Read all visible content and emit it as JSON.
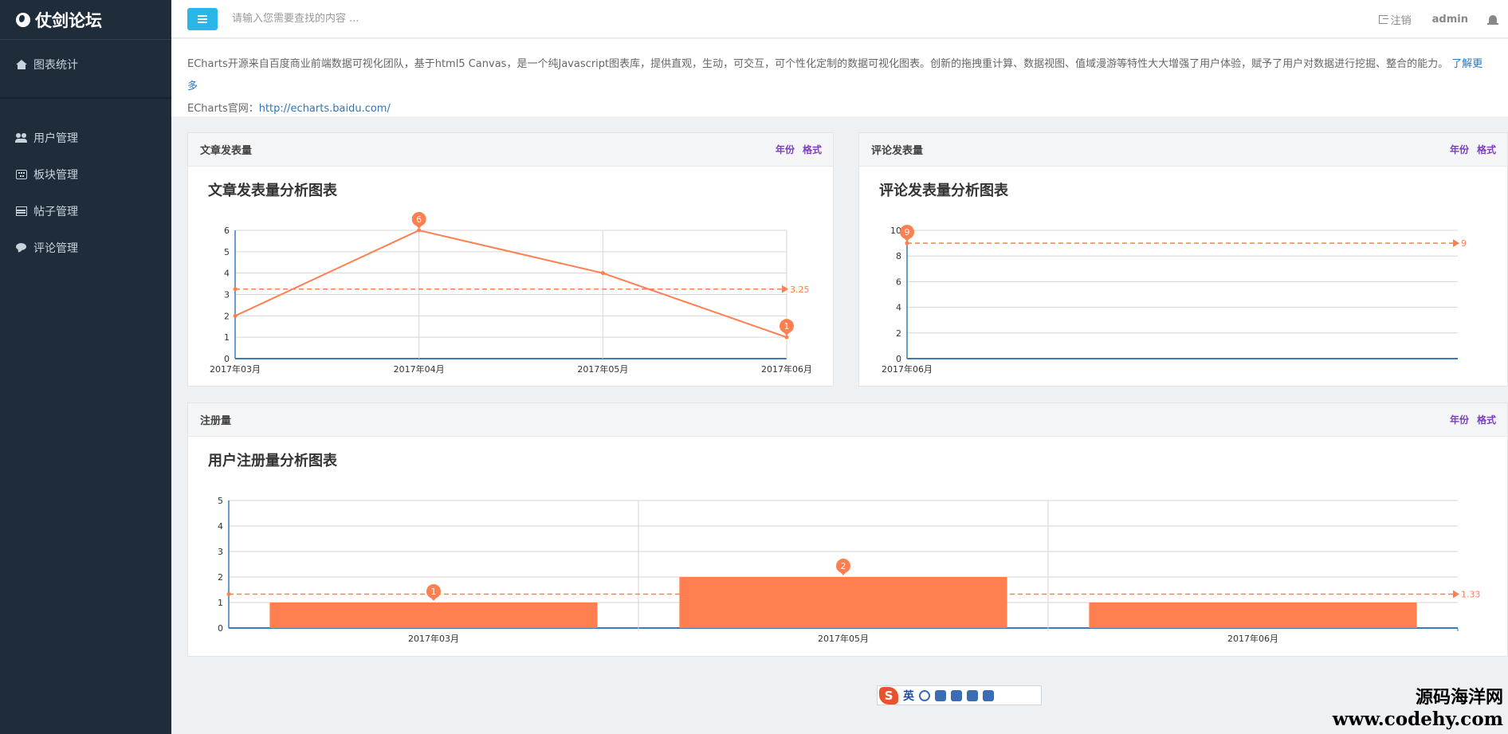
{
  "app": {
    "title": "仗剑论坛"
  },
  "sidebar": {
    "top_item": {
      "label": "图表统计",
      "icon": "home-icon"
    },
    "items": [
      {
        "label": "用户管理",
        "icon": "users-icon"
      },
      {
        "label": "板块管理",
        "icon": "keyboard-icon"
      },
      {
        "label": "帖子管理",
        "icon": "table-icon"
      },
      {
        "label": "评论管理",
        "icon": "comment-icon"
      }
    ]
  },
  "topbar": {
    "search_placeholder": "请输入您需要查找的内容 ...",
    "logout_label": "注销",
    "user": "admin"
  },
  "intro": {
    "text": "ECharts开源来自百度商业前端数据可视化团队，基于html5 Canvas，是一个纯Javascript图表库，提供直观，生动，可交互，可个性化定制的数据可视化图表。创新的拖拽重计算、数据视图、值域漫游等特性大大增强了用户体验，赋予了用户对数据进行挖掘、整合的能力。",
    "learn_more": "了解更多",
    "site_label": "ECharts官网：",
    "site_url": "http://echarts.baidu.com/"
  },
  "panels": {
    "articles": {
      "header": "文章发表量",
      "link_year": "年份",
      "link_format": "格式"
    },
    "comments": {
      "header": "评论发表量",
      "link_year": "年份",
      "link_format": "格式"
    },
    "registrations": {
      "header": "注册量",
      "link_year": "年份",
      "link_format": "格式"
    }
  },
  "colors": {
    "series": "#ff7f50",
    "axis": "#3a7bb7",
    "grid": "#d6d6d6",
    "accent_button": "#29b6e8",
    "sidebar": "#1f2d3a"
  },
  "ime": {
    "logo": "S",
    "mode": "英"
  },
  "watermark": {
    "line1": "源码海洋网",
    "line2": "www.codehy.com"
  },
  "chart_data": [
    {
      "type": "line",
      "title": "文章发表量分析图表",
      "categories": [
        "2017年03月",
        "2017年04月",
        "2017年05月",
        "2017年06月"
      ],
      "values": [
        2,
        6,
        4,
        1
      ],
      "ylim": [
        0,
        6
      ],
      "yticks": [
        0,
        1,
        2,
        3,
        4,
        5,
        6
      ],
      "max_marker": 6,
      "min_marker": 1,
      "average_line": 3.25,
      "grid": true
    },
    {
      "type": "line",
      "title": "评论发表量分析图表",
      "categories": [
        "2017年06月"
      ],
      "values": [
        9
      ],
      "ylim": [
        0,
        10
      ],
      "yticks": [
        0,
        2,
        4,
        6,
        8,
        10
      ],
      "max_marker": 9,
      "average_line": 9,
      "grid": true
    },
    {
      "type": "bar",
      "title": "用户注册量分析图表",
      "categories": [
        "2017年03月",
        "2017年05月",
        "2017年06月"
      ],
      "values": [
        1,
        2,
        1
      ],
      "ylim": [
        0,
        5
      ],
      "yticks": [
        0,
        1,
        2,
        3,
        4,
        5
      ],
      "max_marker": 2,
      "min_marker": 1,
      "average_line": 1.33,
      "grid": true
    }
  ]
}
